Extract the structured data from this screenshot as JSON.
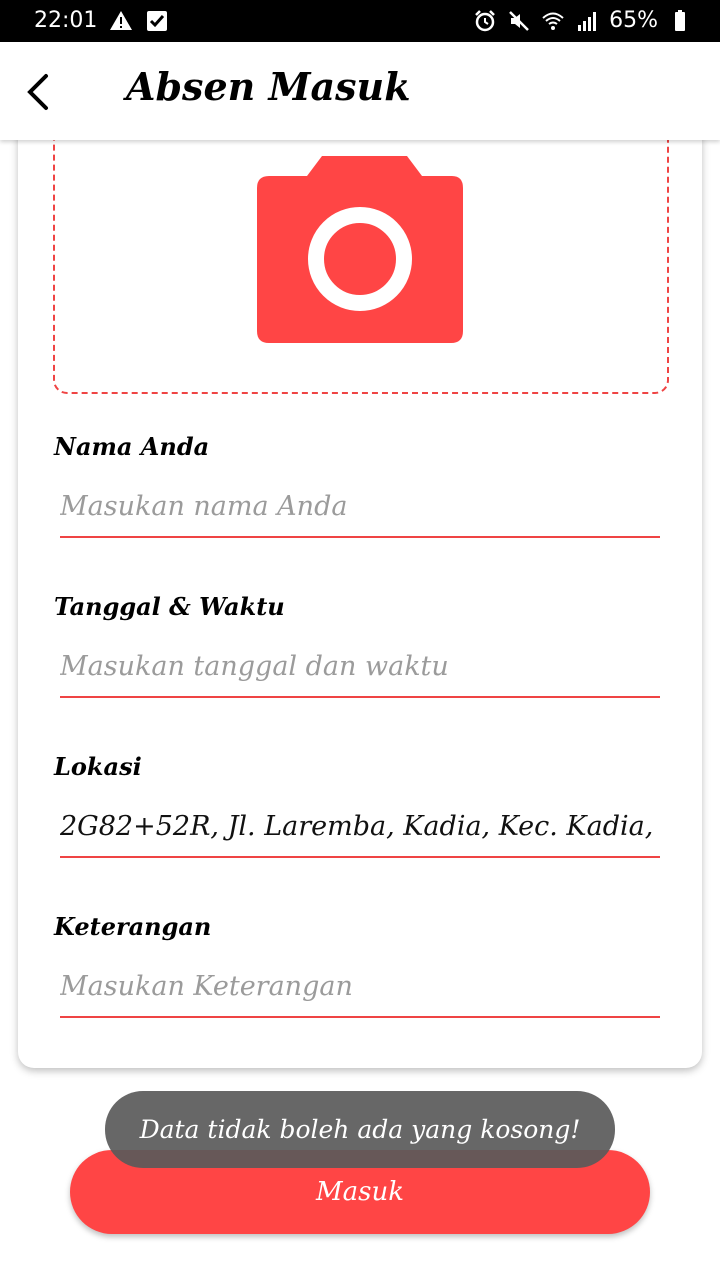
{
  "status_bar": {
    "time": "22:01",
    "battery": "65%",
    "icons_left": [
      "warning-icon",
      "checkbox-icon"
    ],
    "icons_right": [
      "alarm-icon",
      "mute-icon",
      "wifi-icon",
      "signal-icon",
      "battery-icon"
    ]
  },
  "app_bar": {
    "title": "Absen Masuk",
    "back_icon": "back-arrow-icon"
  },
  "photo": {
    "icon": "camera-icon",
    "accent": "#ff4545"
  },
  "form": {
    "name": {
      "label": "Nama Anda",
      "placeholder": "Masukan nama Anda",
      "value": ""
    },
    "datetime": {
      "label": "Tanggal & Waktu",
      "placeholder": "Masukan tanggal dan waktu",
      "value": ""
    },
    "location": {
      "label": "Lokasi",
      "value": "2G82+52R, Jl. Laremba, Kadia, Kec. Kadia,"
    },
    "note": {
      "label": "Keterangan",
      "placeholder": "Masukan Keterangan",
      "value": ""
    }
  },
  "submit": {
    "label": "Masuk"
  },
  "toast": {
    "message": "Data tidak boleh ada yang kosong!"
  },
  "colors": {
    "accent": "#ff4545",
    "underline": "#ef4444",
    "toast_bg": "#5a5a5a"
  }
}
